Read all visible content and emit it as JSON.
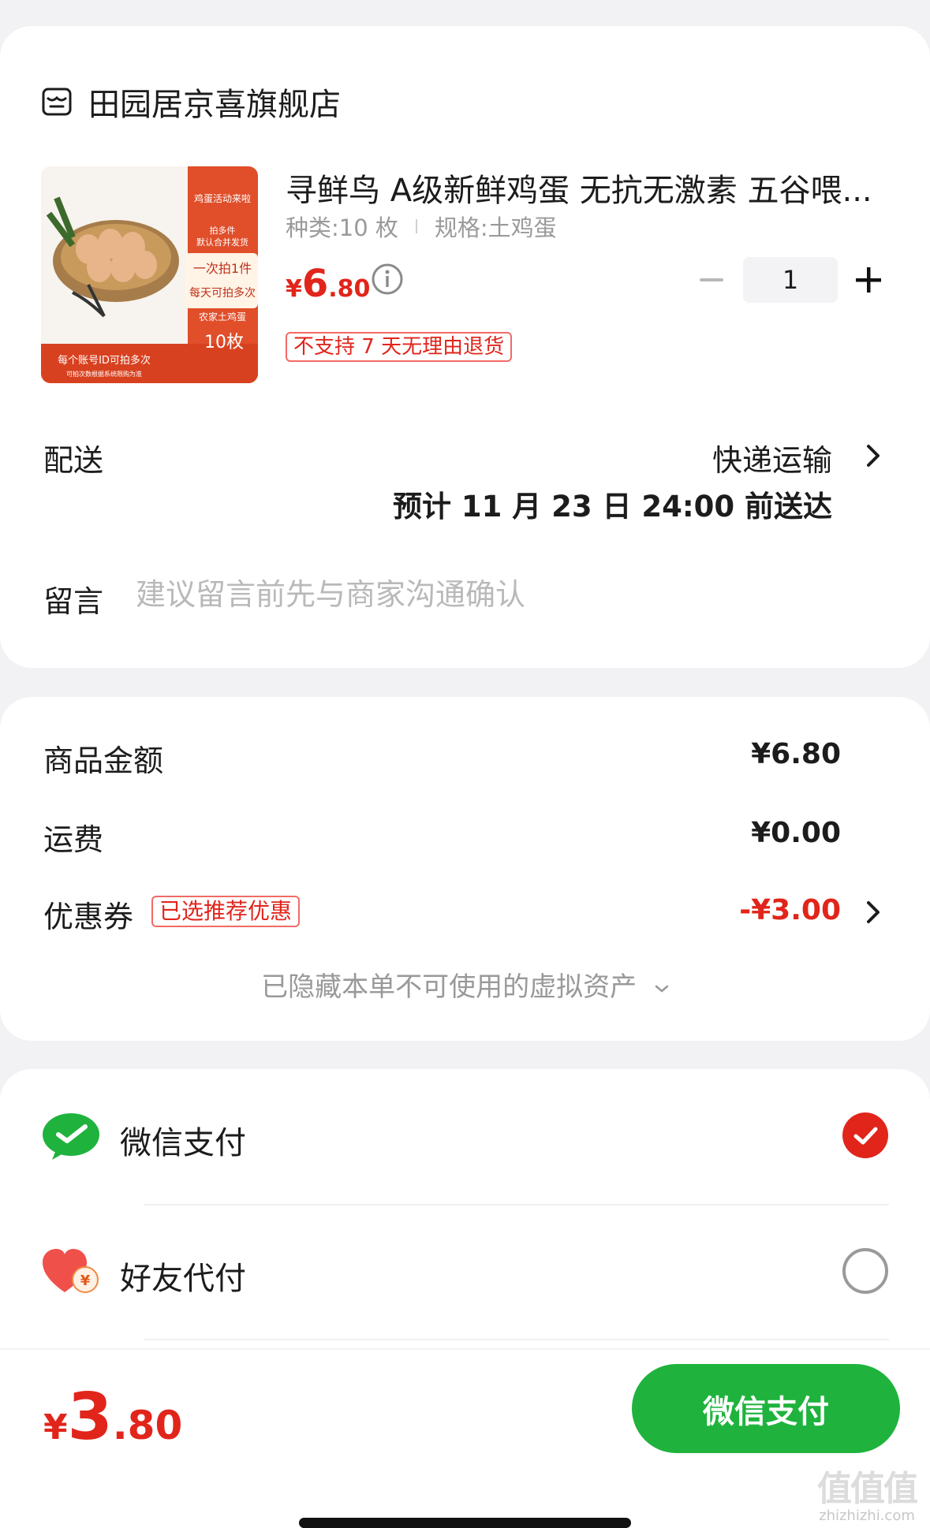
{
  "store": {
    "name": "田园居京喜旗舰店",
    "icon": "store-icon"
  },
  "product": {
    "title": "寻鲜鸟 A级新鲜鸡蛋 无抗无激素 五谷喂...",
    "spec_type": "种类:10 枚",
    "spec_size": "规格:土鸡蛋",
    "price_yen": "¥",
    "price_int": "6",
    "price_dec": ".80",
    "quantity": "1",
    "return_policy": "不支持 7 天无理由退货",
    "image_texts": {
      "banner": "鸡蛋活动来啦",
      "ship_note": "拍多件\n默认合并发货",
      "once": "一次拍1件",
      "daily": "每天可拍多次",
      "kind": "农家土鸡蛋",
      "count": "10枚",
      "account": "每个账号ID可拍多次",
      "footnote": "可拍次数根据系统限购为准"
    }
  },
  "delivery": {
    "label": "配送",
    "method": "快递运输",
    "eta": "预计 11 月 23 日 24:00 前送达"
  },
  "note": {
    "label": "留言",
    "placeholder": "建议留言前先与商家沟通确认"
  },
  "summary": {
    "goods_label": "商品金额",
    "goods_value": "¥6.80",
    "shipping_label": "运费",
    "shipping_value": "¥0.00",
    "coupon_label": "优惠券",
    "coupon_badge": "已选推荐优惠",
    "coupon_value": "-¥3.00",
    "hidden_assets": "已隐藏本单不可使用的虚拟资产"
  },
  "payment": {
    "wechat_label": "微信支付",
    "friend_label": "好友代付",
    "selected": "wechat"
  },
  "footer": {
    "total_yen": "¥",
    "total_int": "3",
    "total_dec": ".80",
    "pay_button": "微信支付",
    "watermark": "值值值",
    "watermark_domain": "zhizhizhi.com"
  },
  "colors": {
    "accent_red": "#e1251b",
    "wechat_green": "#1fb33d"
  }
}
